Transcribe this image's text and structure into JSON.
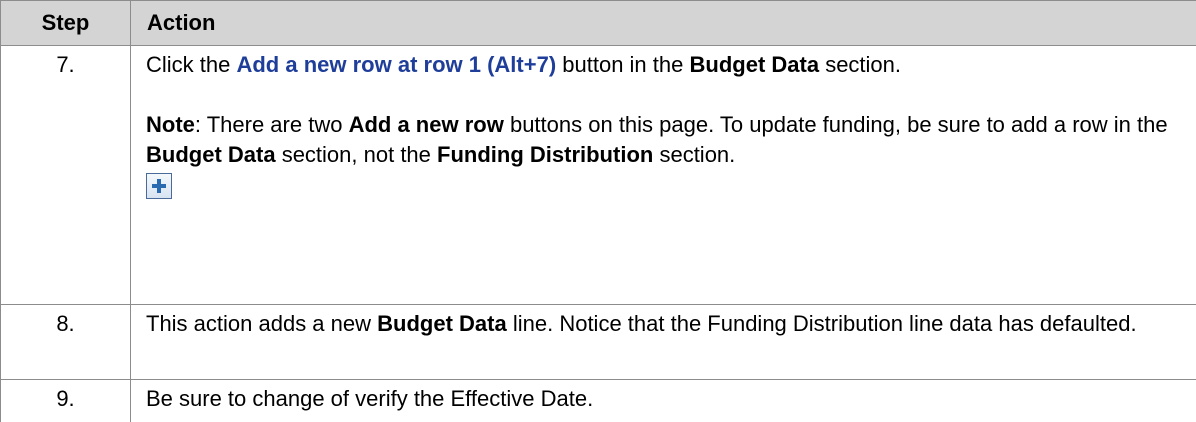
{
  "header": {
    "step": "Step",
    "action": "Action"
  },
  "rows": [
    {
      "step": "7.",
      "click_the": "Click the",
      "button_name": "Add a new row at row 1 (Alt+7)",
      "button_in_the": "button in the",
      "section_name": "Budget Data",
      "section_word": "section.",
      "note_label": "Note",
      "note_text_1": ": There are two",
      "note_button_name": "Add a new row",
      "note_text_2": "buttons on this page. To update funding, be sure to add a row in the",
      "note_section_1": "Budget Data",
      "note_text_3": "section, not the",
      "note_section_2": "Funding Distribution",
      "note_text_4": "section.",
      "icon": "add-row-plus-icon"
    },
    {
      "step": "8.",
      "text_1": "This action adds a new",
      "bold_1": "Budget Data",
      "text_2": "line. Notice that the Funding Distribution line data has defaulted."
    },
    {
      "step": "9.",
      "text_1": "Be sure to change of verify the Effective Date."
    }
  ],
  "colors": {
    "header_bg": "#d4d4d4",
    "border": "#8c8c8c",
    "link_blue": "#1f3e9a",
    "icon_plus": "#2a6ab0"
  }
}
